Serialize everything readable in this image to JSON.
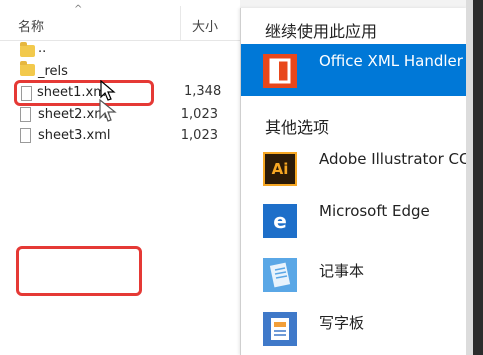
{
  "file_list": {
    "header": {
      "name": "名称",
      "size": "大小",
      "sort_glyph": "^"
    },
    "items": [
      {
        "name": "..",
        "size": "",
        "type": "folder"
      },
      {
        "name": "_rels",
        "size": "",
        "type": "folder"
      },
      {
        "name": "sheet1.xml",
        "size": "1,348",
        "type": "xml"
      },
      {
        "name": "sheet2.xml",
        "size": "1,023",
        "type": "xml"
      },
      {
        "name": "sheet3.xml",
        "size": "1,023",
        "type": "xml"
      }
    ]
  },
  "open_with": {
    "continue_title": "继续使用此应用",
    "other_title": "其他选项",
    "featured_app": {
      "label": "Office XML Handler",
      "icon": "office-icon"
    },
    "apps": [
      {
        "label": "Adobe Illustrator CC",
        "icon": "illustrator-icon",
        "icon_text": "Ai"
      },
      {
        "label": "Microsoft Edge",
        "icon": "edge-icon",
        "icon_text": "e"
      },
      {
        "label": "记事本",
        "icon": "notepad-icon",
        "icon_text": ""
      },
      {
        "label": "写字板",
        "icon": "wordpad-icon",
        "icon_text": ""
      }
    ]
  },
  "colors": {
    "accent": "#0078d7",
    "highlight_border": "#e53935"
  }
}
